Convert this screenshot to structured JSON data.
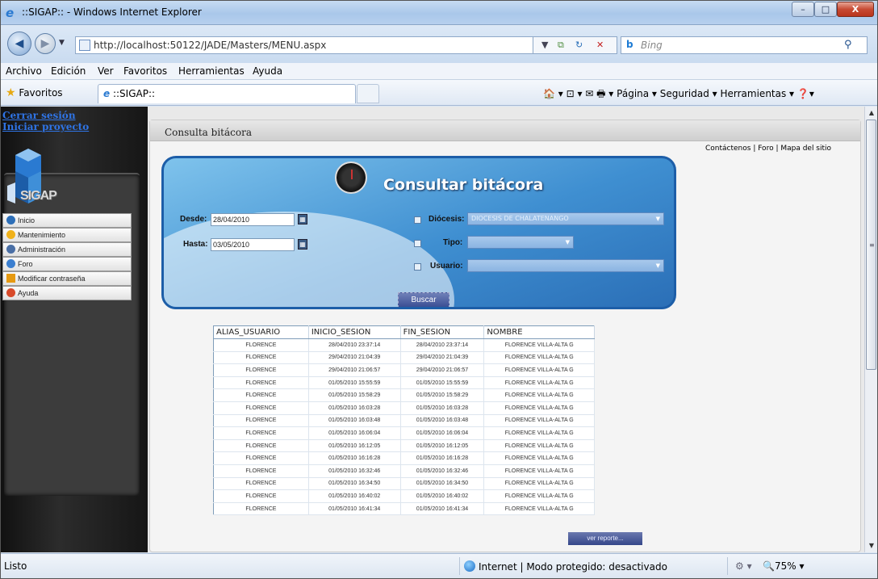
{
  "window": {
    "title": "::SIGAP:: - Windows Internet Explorer",
    "minimize_glyph": "–",
    "maximize_glyph": "□",
    "close_glyph": "X"
  },
  "address_bar": {
    "url": "http://localhost:50122/JADE/Masters/MENU.aspx",
    "back_glyph": "◀",
    "forward_glyph": "▶",
    "search_placeholder": "Bing",
    "search_logo": "b",
    "search_icon": "⚲"
  },
  "menu_bar": [
    "Archivo",
    "Edición",
    "Ver",
    "Favoritos",
    "Herramientas",
    "Ayuda"
  ],
  "favorites_bar": {
    "favorites_label": "Favoritos",
    "tab_title": "::SIGAP::",
    "commands": "🏠 ▾  ⊡ ▾  ✉  🖶 ▾  Página ▾  Seguridad ▾  Herramientas ▾  ❓▾"
  },
  "sidebar": {
    "links": [
      "Cerrar sesión",
      "Iniciar proyecto"
    ],
    "logo_text": "SIGAP",
    "menu": [
      {
        "label": "Inicio",
        "icon": "home-icon",
        "color": "#2d6fb8"
      },
      {
        "label": "Mantenimiento",
        "icon": "wrench-icon",
        "color": "#f0b21b"
      },
      {
        "label": "Administración",
        "icon": "admin-icon",
        "color": "#4a6fa5"
      },
      {
        "label": "Foro",
        "icon": "users-icon",
        "color": "#3b7fd0"
      },
      {
        "label": "Modificar contraseña",
        "icon": "warning-icon",
        "color": "#e69a12"
      },
      {
        "label": "Ayuda",
        "icon": "help-icon",
        "color": "#d84a2a"
      }
    ]
  },
  "frame": {
    "title": "Consulta bitácora",
    "top_links": "Contáctenos | Foro | Mapa del sitio"
  },
  "form": {
    "heading": "Consultar bitácora",
    "desde_label": "Desde:",
    "desde_value": "28/04/2010",
    "hasta_label": "Hasta:",
    "hasta_value": "03/05/2010",
    "diocesis_label": "Diócesis:",
    "diocesis_value": "DIOCESIS DE CHALATENANGO",
    "tipo_label": "Tipo:",
    "tipo_value": "",
    "usuario_label": "Usuario:",
    "usuario_value": "",
    "search_button": "Buscar"
  },
  "table": {
    "columns": [
      "ALIAS_USUARIO",
      "INICIO_SESION",
      "FIN_SESION",
      "NOMBRE"
    ],
    "rows": [
      [
        "FLORENCE",
        "28/04/2010 23:37:14",
        "28/04/2010 23:37:14",
        "FLORENCE VILLA-ALTA G"
      ],
      [
        "FLORENCE",
        "29/04/2010 21:04:39",
        "29/04/2010 21:04:39",
        "FLORENCE VILLA-ALTA G"
      ],
      [
        "FLORENCE",
        "29/04/2010 21:06:57",
        "29/04/2010 21:06:57",
        "FLORENCE VILLA-ALTA G"
      ],
      [
        "FLORENCE",
        "01/05/2010 15:55:59",
        "01/05/2010 15:55:59",
        "FLORENCE VILLA-ALTA G"
      ],
      [
        "FLORENCE",
        "01/05/2010 15:58:29",
        "01/05/2010 15:58:29",
        "FLORENCE VILLA-ALTA G"
      ],
      [
        "FLORENCE",
        "01/05/2010 16:03:28",
        "01/05/2010 16:03:28",
        "FLORENCE VILLA-ALTA G"
      ],
      [
        "FLORENCE",
        "01/05/2010 16:03:48",
        "01/05/2010 16:03:48",
        "FLORENCE VILLA-ALTA G"
      ],
      [
        "FLORENCE",
        "01/05/2010 16:06:04",
        "01/05/2010 16:06:04",
        "FLORENCE VILLA-ALTA G"
      ],
      [
        "FLORENCE",
        "01/05/2010 16:12:05",
        "01/05/2010 16:12:05",
        "FLORENCE VILLA-ALTA G"
      ],
      [
        "FLORENCE",
        "01/05/2010 16:16:28",
        "01/05/2010 16:16:28",
        "FLORENCE VILLA-ALTA G"
      ],
      [
        "FLORENCE",
        "01/05/2010 16:32:46",
        "01/05/2010 16:32:46",
        "FLORENCE VILLA-ALTA G"
      ],
      [
        "FLORENCE",
        "01/05/2010 16:34:50",
        "01/05/2010 16:34:50",
        "FLORENCE VILLA-ALTA G"
      ],
      [
        "FLORENCE",
        "01/05/2010 16:40:02",
        "01/05/2010 16:40:02",
        "FLORENCE VILLA-ALTA G"
      ],
      [
        "FLORENCE",
        "01/05/2010 16:41:34",
        "01/05/2010 16:41:34",
        "FLORENCE VILLA-ALTA G"
      ]
    ],
    "report_button": "ver reporte..."
  },
  "status_bar": {
    "ready": "Listo",
    "zone": "Internet | Modo protegido: desactivado",
    "zoom": "75%"
  }
}
